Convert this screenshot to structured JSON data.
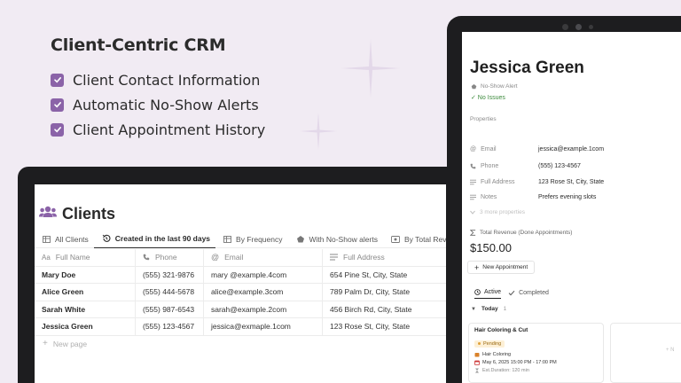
{
  "promo": {
    "title": "Client-Centric CRM",
    "features": [
      "Client Contact Information",
      "Automatic No-Show Alerts",
      "Client Appointment History"
    ]
  },
  "clients_view": {
    "title": "Clients",
    "tabs": [
      {
        "label": "All Clients",
        "icon": "table-icon"
      },
      {
        "label": "Created in the last 90 days",
        "icon": "history-icon"
      },
      {
        "label": "By Frequency",
        "icon": "table-icon"
      },
      {
        "label": "With No-Show alerts",
        "icon": "bell-icon"
      },
      {
        "label": "By Total Revenue (Do",
        "icon": "money-icon"
      }
    ],
    "active_tab": 1,
    "columns": [
      {
        "label": "Full Name",
        "icon": "text-icon"
      },
      {
        "label": "Phone",
        "icon": "phone-icon"
      },
      {
        "label": "Email",
        "icon": "at-icon"
      },
      {
        "label": "Full Address",
        "icon": "lines-icon"
      }
    ],
    "rows": [
      {
        "name": "Mary Doe",
        "phone": "(555) 321-9876",
        "email": "mary @example.4com",
        "address": "654 Pine St, City, State"
      },
      {
        "name": "Alice Green",
        "phone": "(555) 444-5678",
        "email": "alice@example.3com",
        "address": "789 Palm Dr, City, State"
      },
      {
        "name": "Sarah White",
        "phone": "(555) 987-6543",
        "email": "sarah@example.2com",
        "address": "456 Birch Rd, City, State"
      },
      {
        "name": "Jessica Green",
        "phone": "(555) 123-4567",
        "email": "jessica@exmaple.1com",
        "address": "123 Rose St, City, State"
      }
    ],
    "new_page_label": "New page"
  },
  "client_record": {
    "name": "Jessica Green",
    "noshow_label": "No-Show Alert",
    "noshow_status": "✓ No Issues",
    "properties_label": "Properties",
    "properties": [
      {
        "key": "Email",
        "value": "jessica@example.1com"
      },
      {
        "key": "Phone",
        "value": "(555) 123-4567"
      },
      {
        "key": "Full Address",
        "value": "123 Rose St, City, State"
      },
      {
        "key": "Notes",
        "value": "Prefers evening slots"
      }
    ],
    "more_properties": "3 more properties",
    "revenue_label": "Total Revenue (Done Appointments)",
    "revenue_value": "$150.00",
    "new_appointment_label": "New Appointment",
    "appointment_tabs": [
      "Active",
      "Completed"
    ],
    "group": {
      "name": "Today",
      "count": "1"
    },
    "card": {
      "title": "Hair Coloring & Cut",
      "status": "Pending",
      "service": "Hair Coloring",
      "datetime": "May 6, 2025 15:00 PM - 17:00 PM",
      "duration": "Est.Duration: 120 min"
    },
    "accent_green": "#3d8b3d",
    "pending_color": "#fdf0d6"
  },
  "colors": {
    "background": "#f1ebf3",
    "checkbox": "#8b63a8",
    "clients_icon": "#8b63a8"
  }
}
